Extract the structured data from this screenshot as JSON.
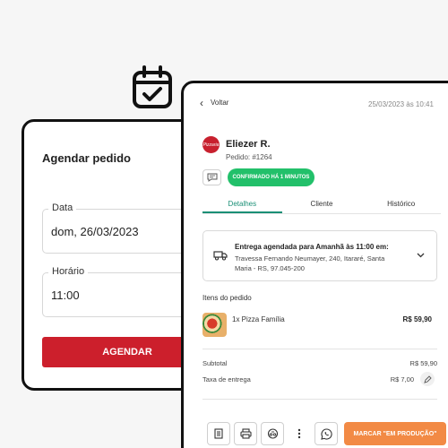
{
  "schedule": {
    "title": "Agendar pedido",
    "date_label": "Data",
    "date_value": "dom, 26/03/2023",
    "time_label": "Horário",
    "time_value": "11:00",
    "submit_label": "AGENDAR"
  },
  "order": {
    "back_label": "Voltar",
    "timestamp": "25/03/2023 às 10:41",
    "avatar_text": "Pizzaria",
    "customer_name": "Eliezer R.",
    "order_number": "Pedido: #1264",
    "status_badge": "CONFIRMADO HÁ 1 MINUTOS",
    "tabs": [
      {
        "label": "Detalhes",
        "active": true
      },
      {
        "label": "Cliente",
        "active": false
      },
      {
        "label": "Histórico",
        "active": false
      }
    ],
    "delivery": {
      "title": "Entrega agendada para Amanhã às 11:00 em:",
      "address": "Travessa Fernando Neumayer, 240, Itararé, Santa Maria - RS, 97.045-200"
    },
    "items_title": "Itens do pedido",
    "items": [
      {
        "name": "1x Pizza Família",
        "price": "R$ 59,90"
      }
    ],
    "subtotal_label": "Subtotal",
    "subtotal_value": "R$ 59,90",
    "fee_label": "Taxa de entrega",
    "fee_value": "R$ 7,00",
    "production_button": "MARCAR \"EM PRODUÇÃO\""
  },
  "colors": {
    "brand_red": "#cc1f2c",
    "confirmed_green": "#22c06a",
    "tab_accent": "#1a8f76",
    "production_orange": "#f28a45"
  },
  "icons": [
    "calendar-check-icon",
    "chevron-left-icon",
    "chat-icon",
    "truck-icon",
    "chevron-down-icon",
    "edit-icon",
    "receipt-icon",
    "printer-icon",
    "motorcycle-icon",
    "more-vertical-icon",
    "whatsapp-icon"
  ]
}
